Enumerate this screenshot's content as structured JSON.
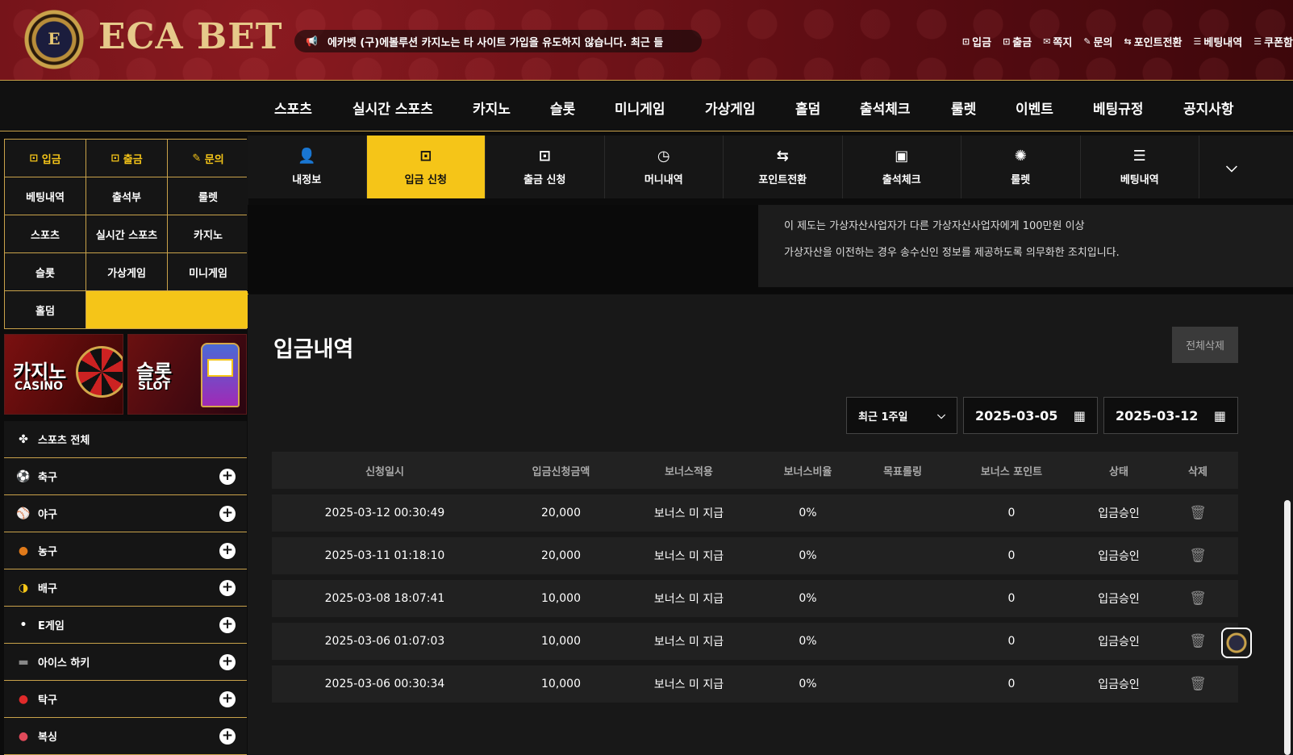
{
  "header": {
    "logo_letter": "E",
    "logo_text": "ECA BET",
    "notice": "에카벳 (구)에볼루션 카지노는 타 사이트 가입을 유도하지 않습니다. 최근 들",
    "links": [
      {
        "icon": "⊡",
        "label": "입금"
      },
      {
        "icon": "⊡",
        "label": "출금"
      },
      {
        "icon": "✉",
        "label": "쪽지"
      },
      {
        "icon": "✎",
        "label": "문의"
      },
      {
        "icon": "⇆",
        "label": "포인트전환"
      },
      {
        "icon": "☰",
        "label": "베팅내역"
      },
      {
        "icon": "☰",
        "label": "쿠폰함"
      }
    ]
  },
  "mainnav": [
    "스포츠",
    "실시간 스포츠",
    "카지노",
    "슬롯",
    "미니게임",
    "가상게임",
    "홀덤",
    "출석체크",
    "룰렛",
    "이벤트",
    "베팅규정",
    "공지사항"
  ],
  "sidebar": {
    "quick": [
      {
        "label": "입금",
        "icon": "⊡"
      },
      {
        "label": "출금",
        "icon": "⊡"
      },
      {
        "label": "문의",
        "icon": "✎"
      }
    ],
    "grid": [
      "베팅내역",
      "출석부",
      "룰렛",
      "스포츠",
      "실시간 스포츠",
      "카지노",
      "슬롯",
      "가상게임",
      "미니게임",
      "홀덤"
    ],
    "banners": [
      {
        "big": "카지노",
        "small": "CASINO"
      },
      {
        "big": "슬롯",
        "small": "SLOT"
      }
    ],
    "sports": [
      {
        "label": "스포츠 전체",
        "icon": "✤",
        "expand": false
      },
      {
        "label": "축구",
        "icon": "⚽",
        "expand": true
      },
      {
        "label": "야구",
        "icon": "⚾",
        "expand": true
      },
      {
        "label": "농구",
        "icon": "●",
        "expand": true
      },
      {
        "label": "배구",
        "icon": "◑",
        "expand": true
      },
      {
        "label": "E게임",
        "icon": "•",
        "expand": true
      },
      {
        "label": "아이스 하키",
        "icon": "▬",
        "expand": true
      },
      {
        "label": "탁구",
        "icon": "●",
        "expand": true
      },
      {
        "label": "복싱",
        "icon": "●",
        "expand": true
      }
    ],
    "plus": "+"
  },
  "tabs": [
    {
      "label": "내정보",
      "icon": "👤"
    },
    {
      "label": "입금 신청",
      "icon": "⊡",
      "active": true
    },
    {
      "label": "출금 신청",
      "icon": "⊡"
    },
    {
      "label": "머니내역",
      "icon": "◷"
    },
    {
      "label": "포인트전환",
      "icon": "⇆"
    },
    {
      "label": "출석체크",
      "icon": "▣"
    },
    {
      "label": "룰렛",
      "icon": "✺"
    },
    {
      "label": "베팅내역",
      "icon": "☰"
    }
  ],
  "tabs_more_icon": "⌵",
  "info": {
    "line1": "이 제도는 가상자산사업자가 다른 가상자산사업자에게 100만원 이상",
    "line2": "가상자산을 이전하는 경우 송수신인 정보를 제공하도록 의무화한 조치입니다."
  },
  "panel": {
    "title": "입금내역",
    "delete_all": "전체삭제",
    "period": "최근 1주일",
    "date_from": "2025-03-05",
    "date_to": "2025-03-12",
    "calendar_icon": "▦",
    "chevron": "⌵"
  },
  "table": {
    "headers": [
      "신청일시",
      "입금신청금액",
      "보너스적용",
      "보너스비율",
      "목표롤링",
      "보너스 포인트",
      "상태",
      "삭제"
    ],
    "rows": [
      [
        "2025-03-12 00:30:49",
        "20,000",
        "보너스 미 지급",
        "0%",
        "",
        "0",
        "입금승인"
      ],
      [
        "2025-03-11 01:18:10",
        "20,000",
        "보너스 미 지급",
        "0%",
        "",
        "0",
        "입금승인"
      ],
      [
        "2025-03-08 18:07:41",
        "10,000",
        "보너스 미 지급",
        "0%",
        "",
        "0",
        "입금승인"
      ],
      [
        "2025-03-06 01:07:03",
        "10,000",
        "보너스 미 지급",
        "0%",
        "",
        "0",
        "입금승인"
      ],
      [
        "2025-03-06 00:30:34",
        "10,000",
        "보너스 미 지급",
        "0%",
        "",
        "0",
        "입금승인"
      ]
    ],
    "trash_icon": "🗑"
  },
  "colors": {
    "accent": "#f5c518",
    "gold_border": "#c9a24a",
    "header_red": "#6a0f15"
  }
}
